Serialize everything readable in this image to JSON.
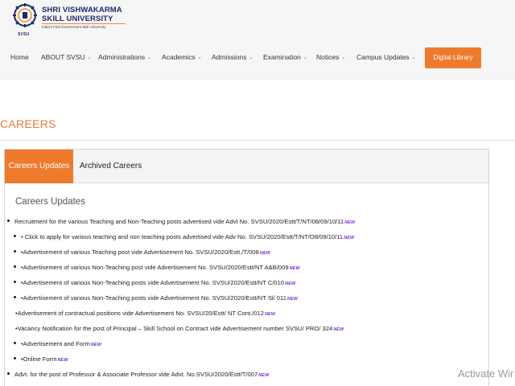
{
  "brand": {
    "line1": "SHRI VISHWAKARMA",
    "line2": "SKILL UNIVERSITY",
    "tagline": "India's First Government Skill University",
    "short": "SVSU",
    "brand_color": "#1d2a6b",
    "accent_color": "#ee7a2d"
  },
  "nav": {
    "items": [
      {
        "label": "Home",
        "has_dropdown": false
      },
      {
        "label": "ABOUT SVSU",
        "has_dropdown": true
      },
      {
        "label": "Administrations",
        "has_dropdown": true
      },
      {
        "label": "Academics",
        "has_dropdown": true
      },
      {
        "label": "Admissions",
        "has_dropdown": true
      },
      {
        "label": "Examination",
        "has_dropdown": true
      },
      {
        "label": "Notices",
        "has_dropdown": true
      },
      {
        "label": "Campus Updates",
        "has_dropdown": true
      }
    ],
    "cta_label": "Digital Library",
    "chevron": "⌄"
  },
  "page": {
    "title": "CAREERS"
  },
  "tabs": {
    "active_label": "Careers Updates",
    "other_label": "Archived Careers"
  },
  "section": {
    "title": "Careers Updates",
    "new_badge": "NEW",
    "items": [
      {
        "text": "Recruitment for the various Teaching and Non-Teaching posts advertised vide Advt No. SVSU/2020/Estt/T/NT/08/09/10/11",
        "level": 0,
        "bullet": "dot"
      },
      {
        "text": "• Click to apply for various teaching and non teaching posts advertised vide Adv No. SVSU/2020/Estt/T/NT/O8/09/10/11",
        "level": 1,
        "bullet": "dot"
      },
      {
        "text": "•Advertisement of various Teaching post vide Advertisement No. SVSU/2020/Estt./T/008",
        "level": 1,
        "bullet": "dot"
      },
      {
        "text": "•Advertisement of various Non-Teaching post vide Advertisement No. SVSU/2020/Estt/NT A&B/009",
        "level": 1,
        "bullet": "dot"
      },
      {
        "text": "•Advertisement of various Non-Teaching posts vide Advertisement No. SVSU/2020/Estt/NT C/010",
        "level": 1,
        "bullet": "dot"
      },
      {
        "text": "•Advertisement of various Non-Teaching posts vide Advertisement No. SVSU/2020/Estt/NT Sl/ 011",
        "level": 1,
        "bullet": "dot"
      },
      {
        "text": "•Advertisement of contractual positions vide Advertisement No. SVSU/20/Estt/ NT Cont./012",
        "level": 0,
        "bullet": "none"
      },
      {
        "text": "•Vacancy Notification for the post of Principal – Skill School on Contract vide Advertisement number SVSU/ PRO/ 324",
        "level": 0,
        "bullet": "none"
      },
      {
        "text": "•Advertisement and Form",
        "level": 1,
        "bullet": "dot"
      },
      {
        "text": "•Online Form",
        "level": 1,
        "bullet": "dot"
      },
      {
        "text": "Advt. for the post of Professor & Associate Professor vide Advt. No.SVSU/2020/Estt/T/007",
        "level": 0,
        "bullet": "dot"
      }
    ]
  },
  "watermark": "Activate Wir"
}
